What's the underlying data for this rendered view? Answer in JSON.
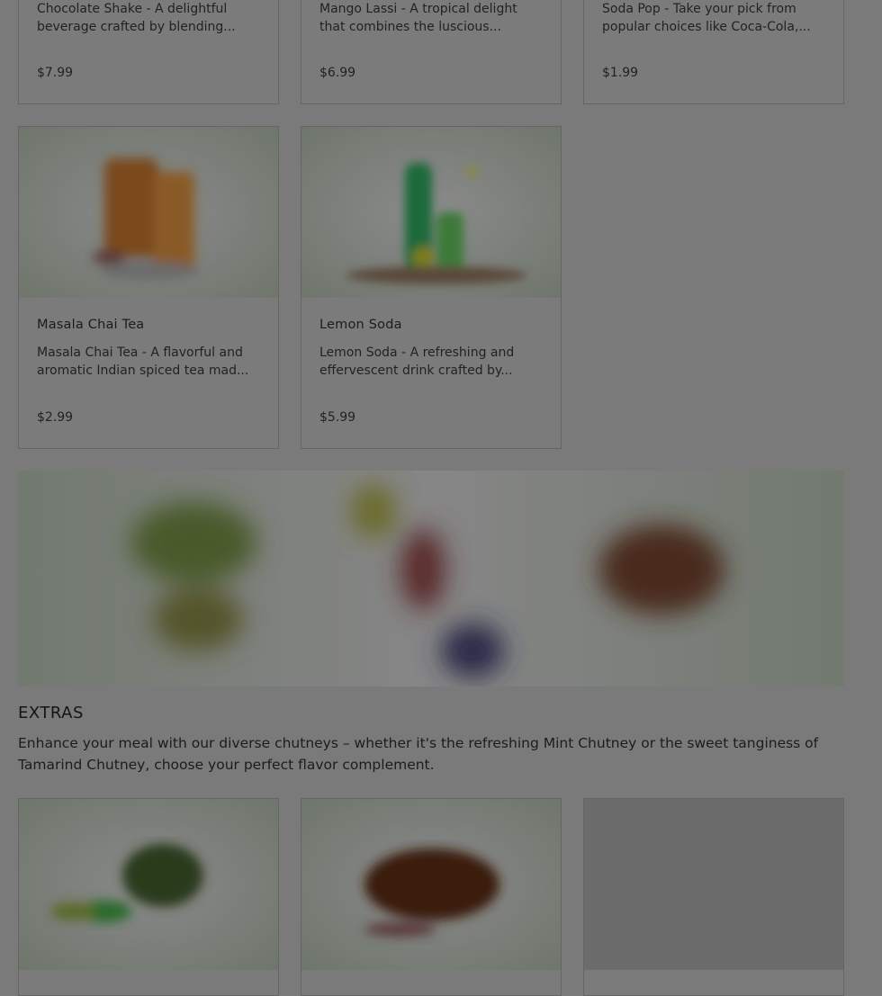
{
  "drinks_row_top": [
    {
      "description": "Chocolate Shake - A delightful beverage crafted by blending...",
      "price": "$7.99"
    },
    {
      "description": "Mango Lassi - A tropical delight that combines the luscious...",
      "price": "$6.99"
    },
    {
      "description": "Soda Pop - Take your pick from popular choices like Coca-Cola,...",
      "price": "$1.99"
    }
  ],
  "drinks_row_mid": [
    {
      "name": "Masala Chai Tea",
      "description": "Masala Chai Tea - A flavorful and aromatic Indian spiced tea mad...",
      "price": "$2.99"
    },
    {
      "name": "Lemon Soda",
      "description": "Lemon Soda - A refreshing and effervescent drink crafted by...",
      "price": "$5.99"
    }
  ],
  "extras": {
    "title": "EXTRAS",
    "description": "Enhance your meal with our diverse chutneys – whether it's the refreshing Mint Chutney or the sweet tanginess of Tamarind Chutney, choose your perfect flavor complement."
  }
}
